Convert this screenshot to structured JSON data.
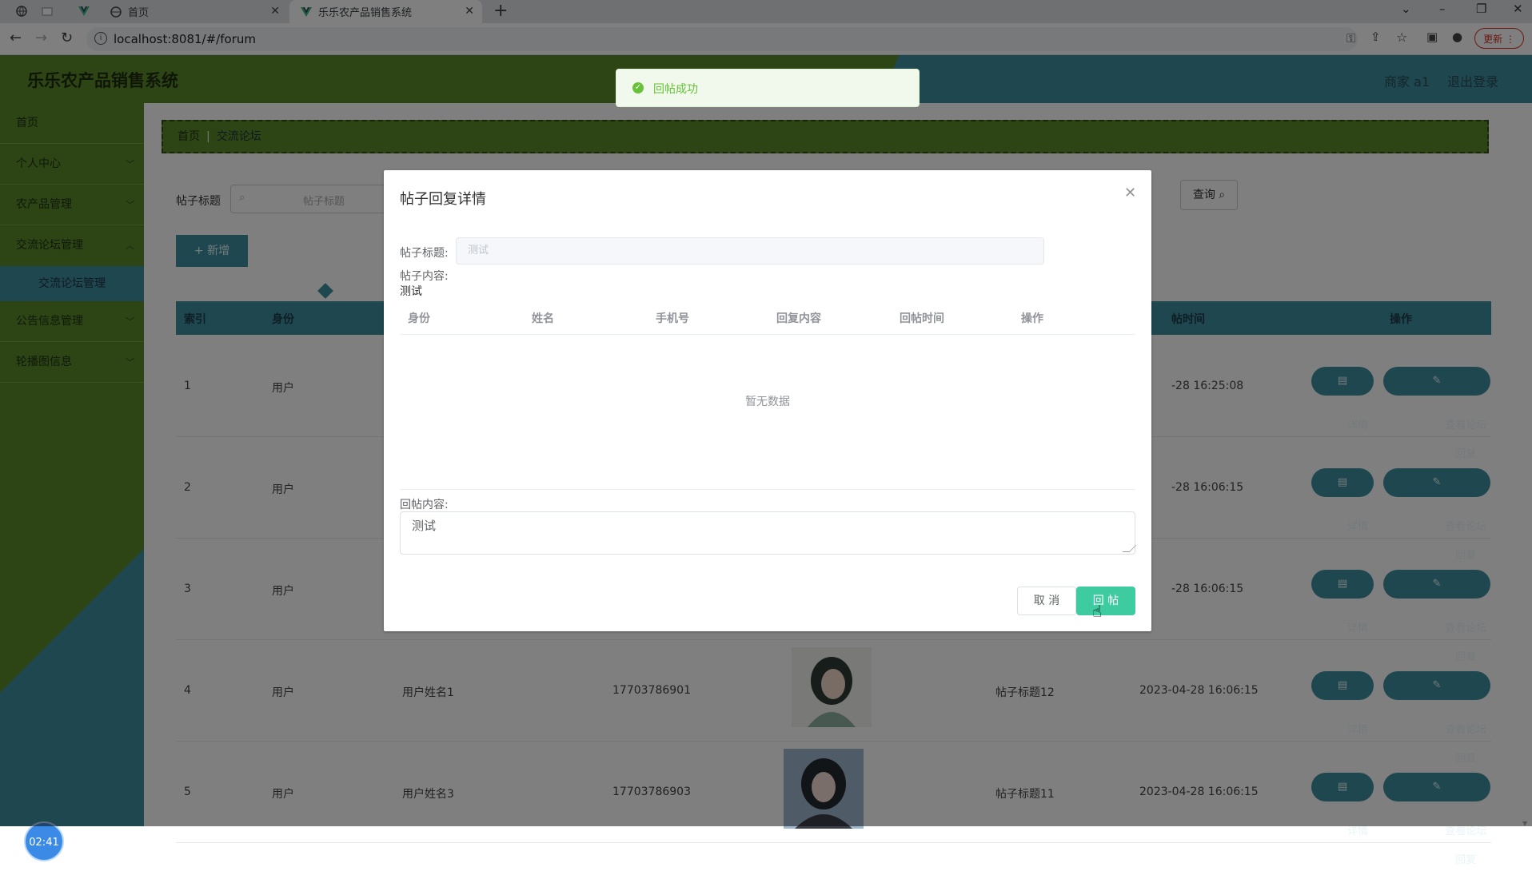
{
  "browser": {
    "tab1_title": "首页",
    "tab2_title": "乐乐农产品销售系统",
    "url": "localhost:8081/#/forum",
    "update_label": "更新"
  },
  "header": {
    "title": "乐乐农产品销售系统",
    "user": "商家 a1",
    "logout": "退出登录"
  },
  "sidebar": {
    "items": [
      {
        "label": "首页"
      },
      {
        "label": "个人中心"
      },
      {
        "label": "农产品管理"
      },
      {
        "label": "交流论坛管理"
      },
      {
        "label": "交流论坛管理"
      },
      {
        "label": "公告信息管理"
      },
      {
        "label": "轮播图信息"
      }
    ],
    "clock": "02:41"
  },
  "breadcrumb": {
    "home": "首页",
    "current": "交流论坛"
  },
  "search": {
    "label": "帖子标题",
    "placeholder": "帖子标题",
    "query_btn": "查询"
  },
  "add_btn": "+ 新增",
  "table": {
    "headers": [
      "索引",
      "身份",
      "帖时间",
      "操作"
    ],
    "rows": [
      {
        "index": "1",
        "role": "用户",
        "name": "",
        "phone": "",
        "title": "",
        "time": "-28 16:25:08"
      },
      {
        "index": "2",
        "role": "用户",
        "name": "",
        "phone": "",
        "title": "",
        "time": "-28 16:06:15"
      },
      {
        "index": "3",
        "role": "用户",
        "name": "",
        "phone": "",
        "title": "",
        "time": "-28 16:06:15"
      },
      {
        "index": "4",
        "role": "用户",
        "name": "用户姓名1",
        "phone": "17703786901",
        "title": "帖子标题12",
        "time": "2023-04-28 16:06:15"
      },
      {
        "index": "5",
        "role": "用户",
        "name": "用户姓名3",
        "phone": "17703786903",
        "title": "帖子标题11",
        "time": "2023-04-28 16:06:15"
      }
    ],
    "detail_btn": "详情",
    "view_btn": "查看论坛回复"
  },
  "modal": {
    "title": "帖子回复详情",
    "title_label": "帖子标题:",
    "title_value": "测试",
    "content_label": "帖子内容:",
    "content_value": "测试",
    "columns": [
      "身份",
      "姓名",
      "手机号",
      "回复内容",
      "回帖时间",
      "操作"
    ],
    "empty_text": "暂无数据",
    "reply_label": "回帖内容:",
    "reply_value": "测试",
    "cancel": "取 消",
    "submit": "回 帖"
  },
  "toast": {
    "message": "回帖成功"
  }
}
